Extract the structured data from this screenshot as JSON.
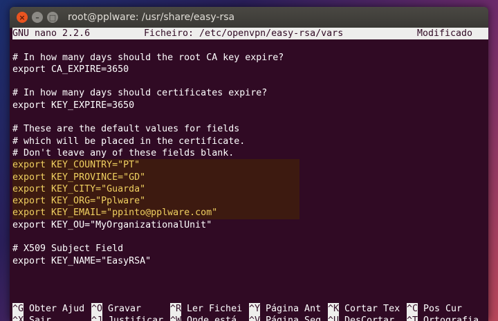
{
  "window": {
    "title": "root@pplware: /usr/share/easy-rsa"
  },
  "header": {
    "app": "GNU nano 2.2.6",
    "file": "Ficheiro: /etc/openvpn/easy-rsa/vars",
    "status": "Modificado"
  },
  "lines": [
    "",
    "# In how many days should the root CA key expire?",
    "export CA_EXPIRE=3650",
    "",
    "# In how many days should certificates expire?",
    "export KEY_EXPIRE=3650",
    "",
    "# These are the default values for fields",
    "# which will be placed in the certificate.",
    "# Don't leave any of these fields blank.",
    "export KEY_COUNTRY=\"PT\"",
    "export KEY_PROVINCE=\"GD\"",
    "export KEY_CITY=\"Guarda\"",
    "export KEY_ORG=\"Pplware\"",
    "export KEY_EMAIL=\"ppinto@pplware.com\"",
    "export KEY_OU=\"MyOrganizationalUnit\"",
    "",
    "# X509 Subject Field",
    "export KEY_NAME=\"EasyRSA\"",
    "",
    "",
    "",
    ""
  ],
  "shortcuts_row1": [
    {
      "key": "^G",
      "label": " Obter Ajud"
    },
    {
      "key": "^O",
      "label": " Gravar"
    },
    {
      "key": "^R",
      "label": " Ler Fichei"
    },
    {
      "key": "^Y",
      "label": " Página Ant"
    },
    {
      "key": "^K",
      "label": " Cortar Tex"
    },
    {
      "key": "^C",
      "label": " Pos Cur"
    }
  ],
  "shortcuts_row2": [
    {
      "key": "^X",
      "label": " Sair"
    },
    {
      "key": "^J",
      "label": " Justificar"
    },
    {
      "key": "^W",
      "label": " Onde está"
    },
    {
      "key": "^V",
      "label": " Página Seg"
    },
    {
      "key": "^U",
      "label": " DesCortar"
    },
    {
      "key": "^T",
      "label": " Ortografia"
    }
  ]
}
